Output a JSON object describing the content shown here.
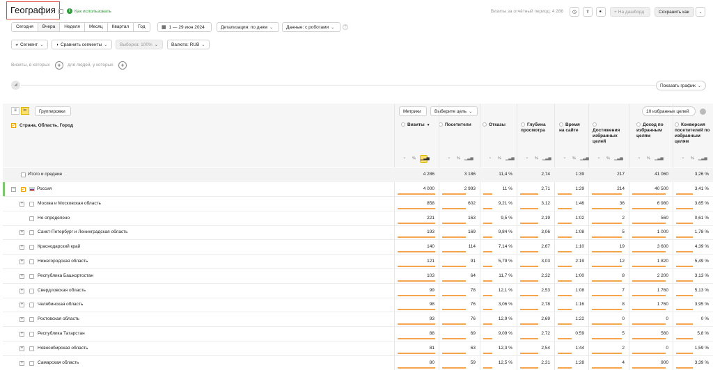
{
  "header": {
    "title": "География",
    "how_to_use": "Как использовать",
    "visits_label": "Визиты за отчётный период: 4 286",
    "to_dashboard": "На дашборд",
    "save_as": "Сохранить как"
  },
  "periods": [
    "Сегодня",
    "Вчера",
    "Неделя",
    "Месяц",
    "Квартал",
    "Год"
  ],
  "date_range": "1 — 29 июн 2024",
  "detail": "Детализация: по дням",
  "data_robots": "Данные: с роботами",
  "segment": "Сегмент",
  "compare": "Сравнить сегменты",
  "sample": "Выборка: 100%",
  "currency": "Валюта: RUB",
  "filters": {
    "visits_where": "Визиты, в которых",
    "people_where": "для людей, у которых"
  },
  "show_chart": "Показать график",
  "table": {
    "groupings": "Группировки",
    "metrics": "Метрики",
    "choose_goal": "Выберите цель",
    "favorite_goals": "10 избранных целей",
    "dimension_header": "Страна, Область, Город",
    "columns": [
      "Визиты",
      "Посетители",
      "Отказы",
      "Глубина просмотра",
      "Время на сайте",
      "Достижения избранных целей",
      "Доход по избранным целям",
      "Конверсия посетителей по избранным целям"
    ],
    "sort_indicator": "▼",
    "totals": {
      "label": "Итого и средние",
      "values": [
        "4 286",
        "3 186",
        "11,4 %",
        "2,74",
        "1:39",
        "217",
        "41 060",
        "3,26 %"
      ]
    },
    "rows": [
      {
        "name": "Россия",
        "level": 0,
        "values": [
          "4 000",
          "2 993",
          "11 %",
          "2,71",
          "1:29",
          "214",
          "40 500",
          "3,41 %"
        ]
      },
      {
        "name": "Москва и Московская область",
        "level": 1,
        "values": [
          "858",
          "602",
          "9,21 %",
          "3,12",
          "1:46",
          "36",
          "6 980",
          "3,65 %"
        ]
      },
      {
        "name": "Не определено",
        "level": 1,
        "noexp": true,
        "values": [
          "221",
          "163",
          "9,5 %",
          "2,19",
          "1:02",
          "2",
          "560",
          "0,61 %"
        ]
      },
      {
        "name": "Санкт-Петербург и Ленинградская область",
        "level": 1,
        "values": [
          "193",
          "169",
          "9,84 %",
          "3,06",
          "1:08",
          "5",
          "1 000",
          "1,78 %"
        ]
      },
      {
        "name": "Краснодарский край",
        "level": 1,
        "values": [
          "140",
          "114",
          "7,14 %",
          "2,67",
          "1:10",
          "19",
          "3 600",
          "4,39 %"
        ]
      },
      {
        "name": "Нижегородская область",
        "level": 1,
        "values": [
          "121",
          "91",
          "5,79 %",
          "3,03",
          "2:19",
          "12",
          "1 820",
          "5,49 %"
        ]
      },
      {
        "name": "Республика Башкортостан",
        "level": 1,
        "values": [
          "103",
          "64",
          "11,7 %",
          "2,32",
          "1:00",
          "8",
          "2 200",
          "3,13 %"
        ]
      },
      {
        "name": "Свердловская область",
        "level": 1,
        "values": [
          "99",
          "78",
          "12,1 %",
          "2,53",
          "1:08",
          "7",
          "1 760",
          "5,13 %"
        ]
      },
      {
        "name": "Челябинская область",
        "level": 1,
        "values": [
          "98",
          "76",
          "3,06 %",
          "2,78",
          "1:16",
          "8",
          "1 760",
          "3,95 %"
        ]
      },
      {
        "name": "Ростовская область",
        "level": 1,
        "values": [
          "93",
          "76",
          "12,9 %",
          "2,69",
          "1:22",
          "0",
          "0",
          "0 %"
        ]
      },
      {
        "name": "Республика Татарстан",
        "level": 1,
        "values": [
          "88",
          "69",
          "9,09 %",
          "2,72",
          "0:59",
          "5",
          "560",
          "5,8 %"
        ]
      },
      {
        "name": "Новосибирская область",
        "level": 1,
        "values": [
          "81",
          "63",
          "12,3 %",
          "2,54",
          "1:44",
          "2",
          "0",
          "1,59 %"
        ]
      },
      {
        "name": "Самарская область",
        "level": 1,
        "values": [
          "80",
          "59",
          "12,5 %",
          "2,31",
          "1:28",
          "4",
          "900",
          "3,39 %"
        ]
      }
    ]
  },
  "colors": {
    "accent": "#f5a64c",
    "highlight_border": "#e53935",
    "green": "#2e9c3a",
    "yellow": "#ffdf70"
  },
  "bar_fractions": [
    1.0,
    0.7,
    0.3,
    0.6,
    0.5,
    0.9,
    0.9,
    0.5
  ]
}
